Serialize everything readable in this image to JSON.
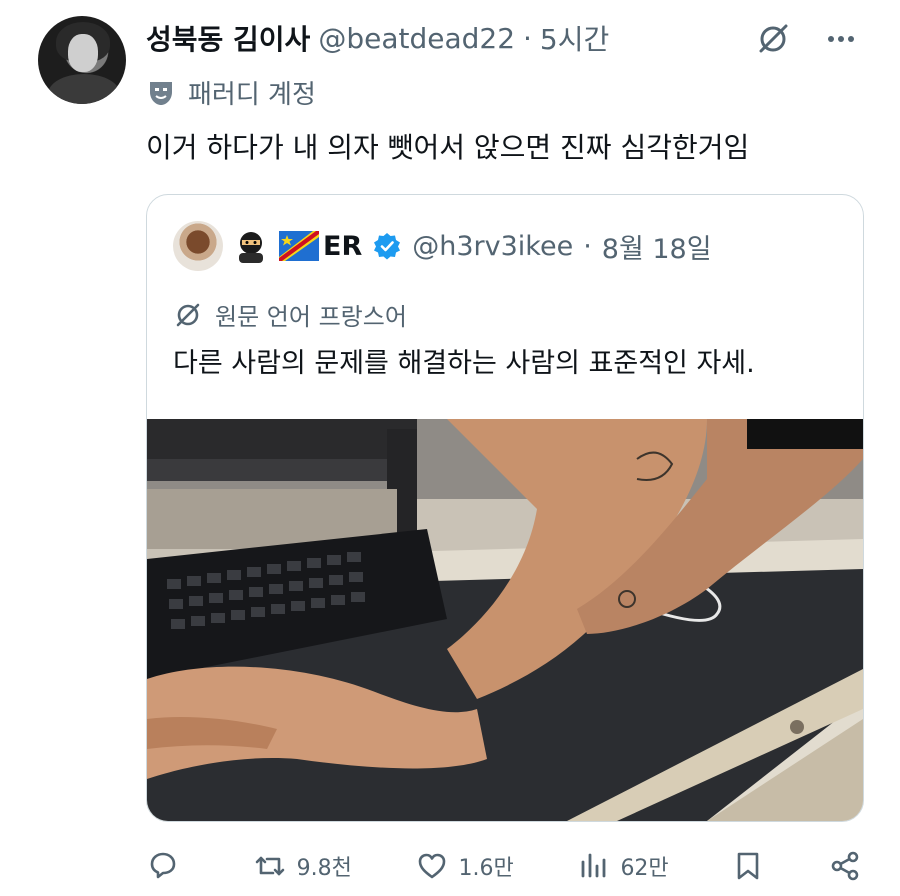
{
  "author": {
    "name": "성북동 김이사",
    "handle": "@beatdead22",
    "separator": "·",
    "time": "5시간",
    "parody_label": "패러디 계정",
    "avatar_icon": "avatar-image"
  },
  "tweet": {
    "text": "이거 하다가 내 의자 뺏어서 앉으면 진짜 심각한거임"
  },
  "quoted": {
    "display_name": "ER",
    "handle": "@h3rv3ikee",
    "separator": "·",
    "date": "8월 18일",
    "translated_label": "원문 언어 프랑스어",
    "text": "다른 사람의 문제를 해결하는 사람의 표준적인 자세.",
    "image_icon": "photo-keyboard-arm-stretch"
  },
  "actions": {
    "reply_count": "",
    "retweet_count": "9.8천",
    "like_count": "1.6만",
    "views_count": "62만"
  },
  "colors": {
    "text_primary": "#0f1419",
    "text_muted": "#536471",
    "border": "#cfd9de",
    "verified": "#1d9bf0"
  }
}
